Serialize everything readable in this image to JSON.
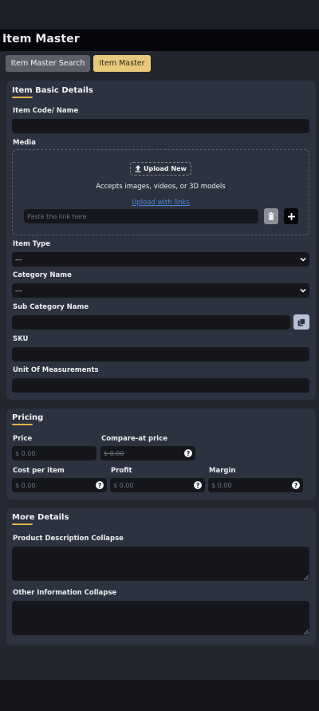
{
  "header": {
    "title": "Item Master"
  },
  "tabs": [
    {
      "label": "Item Master Search"
    },
    {
      "label": "Item Master"
    }
  ],
  "basic": {
    "title": "Item Basic Details",
    "item_code_label": "Item Code/ Name",
    "item_code_value": "",
    "media_label": "Media",
    "upload_new": "Upload New",
    "accepts": "Accepts images, videos, or 3D models",
    "upload_links": "Upload with links",
    "link_placeholder": "Paste the link here",
    "item_type_label": "Item Type",
    "item_type_value": "---",
    "category_label": "Category Name",
    "category_value": "---",
    "sub_category_label": "Sub Category Name",
    "sub_category_value": "",
    "sku_label": "SKU",
    "sku_value": "",
    "uom_label": "Unit Of Measurements",
    "uom_value": ""
  },
  "pricing": {
    "title": "Pricing",
    "price_label": "Price",
    "price_value": "$ 0.00",
    "compare_label": "Compare-at price",
    "compare_value": "$ 0.00",
    "cost_label": "Cost per item",
    "cost_value": "$ 0.00",
    "profit_label": "Profit",
    "profit_value": "$ 0.00",
    "margin_label": "Margin",
    "margin_value": "$ 0.00",
    "help_glyph": "?"
  },
  "more": {
    "title": "More Details",
    "product_desc_label": "Product Description Collapse",
    "other_info_label": "Other Information Collapse"
  },
  "colors": {
    "accent": "#e3b74a",
    "active_tab": "#e8c97c",
    "card_bg": "#2d3240",
    "field_bg": "#15171d",
    "link": "#4b84d6"
  }
}
